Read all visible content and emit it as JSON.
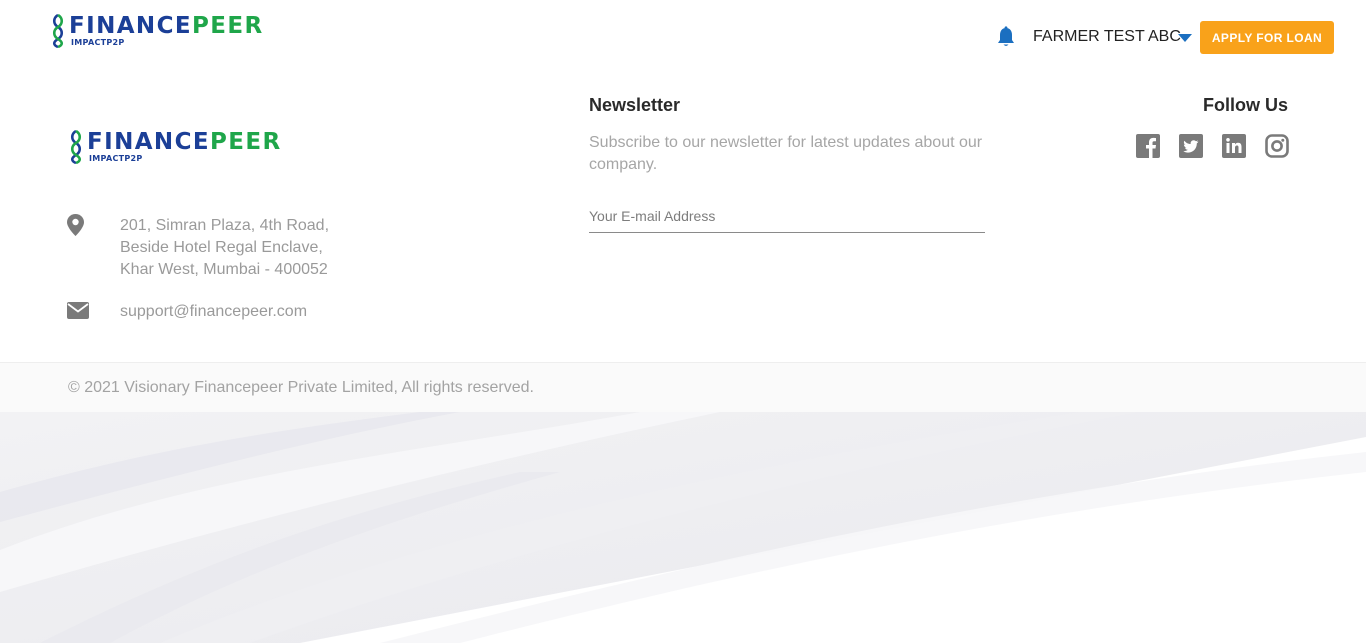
{
  "brand": {
    "name_part1": "FINANCE",
    "name_part2": "PEER",
    "tagline": "IMPACTP2P",
    "colors": {
      "blue": "#1b3f97",
      "green": "#1fa64a"
    }
  },
  "header": {
    "user_name": "FARMER TEST ABC",
    "apply_button": "APPLY FOR LOAN",
    "bell_icon": "bell-icon",
    "accent_color": "#f9a21a"
  },
  "footer": {
    "address_lines": [
      "201, Simran Plaza, 4th Road,",
      "Beside Hotel Regal Enclave,",
      "Khar West, Mumbai - 400052"
    ],
    "email": "support@financepeer.com",
    "newsletter": {
      "heading": "Newsletter",
      "description": "Subscribe to our newsletter for latest updates about our company.",
      "placeholder": "Your E-mail Address"
    },
    "follow": {
      "heading": "Follow Us",
      "icons": [
        "facebook-icon",
        "twitter-icon",
        "linkedin-icon",
        "instagram-icon"
      ]
    },
    "copyright": "© 2021 Visionary Financepeer Private Limited, All rights reserved."
  }
}
